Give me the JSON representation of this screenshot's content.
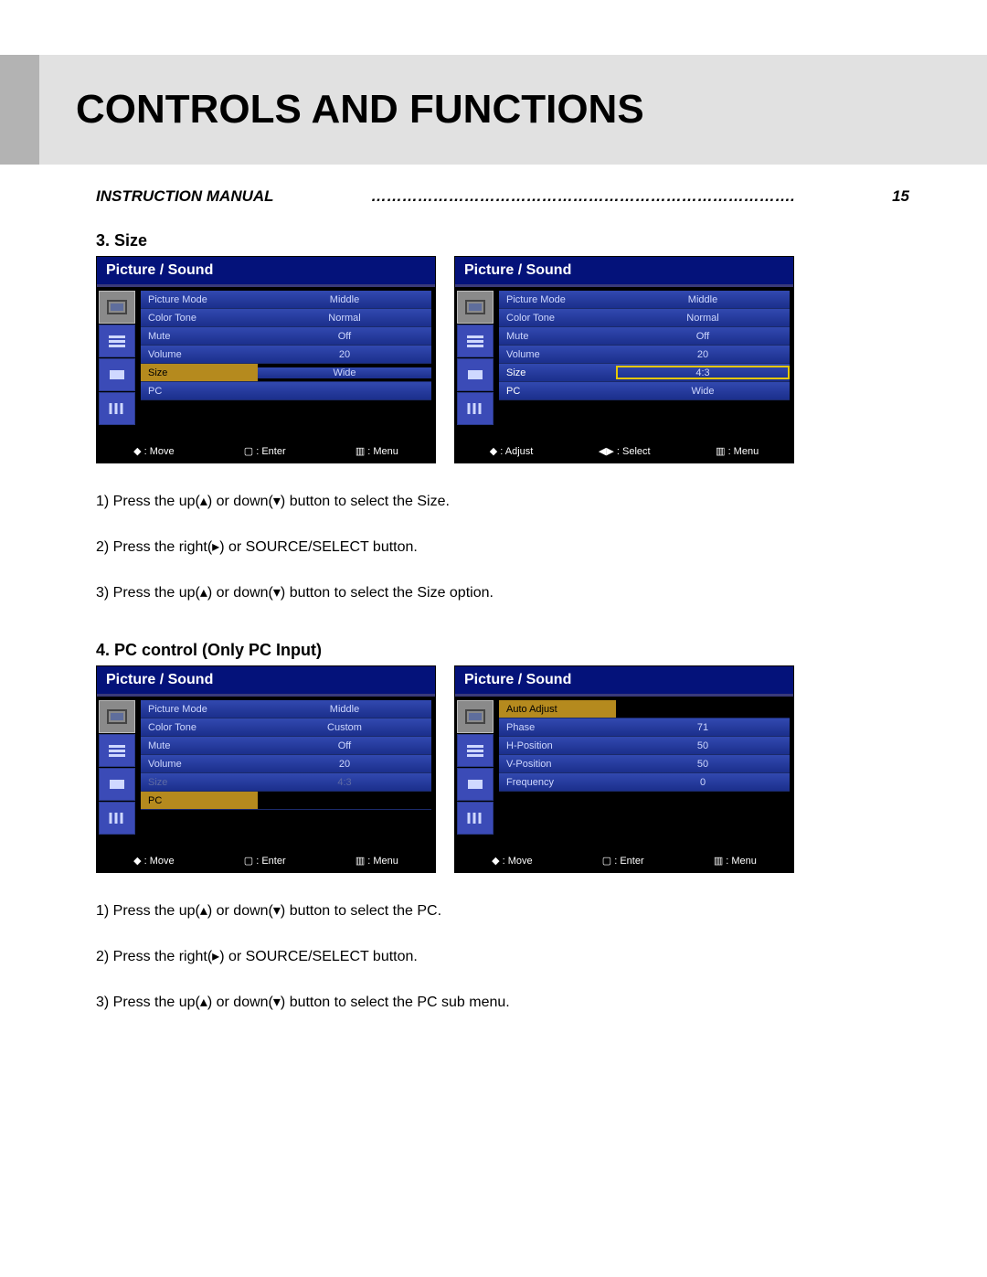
{
  "banner": {
    "title": "CONTROLS AND FUNCTIONS"
  },
  "manual_line": {
    "left": "INSTRUCTION MANUAL",
    "dots": "……………………………………………………………………….",
    "page": "15"
  },
  "section1": {
    "heading": "3. Size",
    "osd_title": "Picture / Sound",
    "left_rows": [
      {
        "label": "Picture Mode",
        "value": "Middle",
        "cls": "norm"
      },
      {
        "label": "Color Tone",
        "value": "Normal",
        "cls": "norm"
      },
      {
        "label": "Mute",
        "value": "Off",
        "cls": "norm"
      },
      {
        "label": "Volume",
        "value": "20",
        "cls": "norm"
      },
      {
        "label": "Size",
        "value": "Wide",
        "cls": "sel-lab"
      },
      {
        "label": "PC",
        "value": "",
        "cls": "norm"
      }
    ],
    "left_foot": {
      "a": "◆ : Move",
      "b": "▢ : Enter",
      "c": "▥ : Menu"
    },
    "right_rows": [
      {
        "label": "Picture Mode",
        "value": "Middle",
        "cls": "norm"
      },
      {
        "label": "Color Tone",
        "value": "Normal",
        "cls": "norm"
      },
      {
        "label": "Mute",
        "value": "Off",
        "cls": "norm"
      },
      {
        "label": "Volume",
        "value": "20",
        "cls": "norm"
      },
      {
        "label": "Size",
        "value": "4:3",
        "cls": "norm sel-yellow"
      },
      {
        "label": "PC",
        "value": "Wide",
        "cls": "norm extra"
      }
    ],
    "right_foot": {
      "a": "◆ : Adjust",
      "b": "◀▶ : Select",
      "c": "▥ : Menu"
    },
    "instr": {
      "l1": "1) Press the up(▴) or down(▾) button to select the Size.",
      "l2": "2) Press the right(▸) or SOURCE/SELECT button.",
      "l3": "3) Press the up(▴) or down(▾) button to select the Size option."
    }
  },
  "section2": {
    "heading": "4. PC control (Only PC Input)",
    "osd_title": "Picture / Sound",
    "left_rows": [
      {
        "label": "Picture Mode",
        "value": "Middle",
        "cls": "norm"
      },
      {
        "label": "Color Tone",
        "value": "Custom",
        "cls": "norm"
      },
      {
        "label": "Mute",
        "value": "Off",
        "cls": "norm"
      },
      {
        "label": "Volume",
        "value": "20",
        "cls": "norm"
      },
      {
        "label": "Size",
        "value": "4:3",
        "cls": "norm dim"
      },
      {
        "label": "PC",
        "value": "",
        "cls": "sel-lab"
      }
    ],
    "left_foot": {
      "a": "◆ : Move",
      "b": "▢ : Enter",
      "c": "▥ : Menu"
    },
    "right_rows": [
      {
        "label": "Auto Adjust",
        "value": "",
        "cls": "sel-lab"
      },
      {
        "label": "Phase",
        "value": "71",
        "cls": "norm"
      },
      {
        "label": "H-Position",
        "value": "50",
        "cls": "norm"
      },
      {
        "label": "V-Position",
        "value": "50",
        "cls": "norm"
      },
      {
        "label": "Frequency",
        "value": "0",
        "cls": "norm"
      }
    ],
    "right_foot": {
      "a": "◆ : Move",
      "b": "▢ : Enter",
      "c": "▥ : Menu"
    },
    "instr": {
      "l1": "1) Press the up(▴) or down(▾) button to select the PC.",
      "l2": "2) Press the right(▸) or SOURCE/SELECT button.",
      "l3": "3) Press the up(▴) or down(▾) button to select the PC sub menu."
    }
  }
}
